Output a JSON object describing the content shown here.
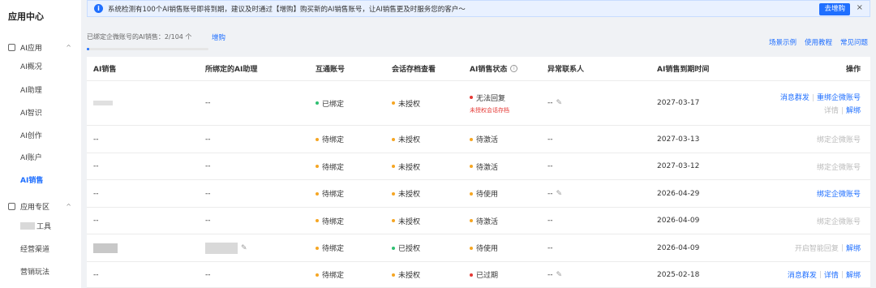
{
  "sidebar": {
    "title": "应用中心",
    "groups": [
      {
        "label": "AI应用",
        "chevron": "^",
        "icon": "grid-icon"
      },
      {
        "label": "应用专区",
        "chevron": "^",
        "icon": "box-icon"
      }
    ],
    "ai_items": [
      "AI概况",
      "AI助理",
      "AI智识",
      "AI创作",
      "AI账户",
      "AI销售"
    ],
    "zone_items": [
      "工具",
      "经营渠道",
      "营销玩法"
    ]
  },
  "notice": {
    "icon": "info-icon",
    "text": "系统检测有100个AI销售账号即将到期，建议及时通过【增购】购买新的AI销售账号，让AI销售更及时服务您的客户～",
    "button": "去增购",
    "close": "×"
  },
  "stats": {
    "text": "已绑定企微账号的AI销售：2/104 个",
    "buy_link": "增购",
    "progress_fraction": 0.019
  },
  "top_links": [
    "场景示例",
    "使用教程",
    "常见问题"
  ],
  "table": {
    "headers": [
      "AI销售",
      "所绑定的AI助理",
      "互通账号",
      "会话存档查看",
      "AI销售状态",
      "异常联系人",
      "AI销售到期时间",
      "操作"
    ],
    "rows": [
      {
        "sales": "",
        "assistant": "--",
        "account": "已绑定",
        "archive": "未授权",
        "status": "无法回复",
        "status_sub": "未授权会话存档",
        "abnormal": "--",
        "expire": "2027-03-17",
        "ops": [
          "消息群发",
          "重绑企微账号",
          "详情",
          "解绑"
        ]
      },
      {
        "sales": "--",
        "assistant": "--",
        "account": "待绑定",
        "archive": "未授权",
        "status": "待激活",
        "status_sub": "",
        "abnormal": "--",
        "expire": "2027-03-13",
        "ops": [
          "绑定企微账号"
        ]
      },
      {
        "sales": "--",
        "assistant": "--",
        "account": "待绑定",
        "archive": "未授权",
        "status": "待激活",
        "status_sub": "",
        "abnormal": "--",
        "expire": "2027-03-12",
        "ops": [
          "绑定企微账号"
        ]
      },
      {
        "sales": "--",
        "assistant": "--",
        "account": "待绑定",
        "archive": "未授权",
        "status": "待使用",
        "status_sub": "",
        "abnormal": "--",
        "expire": "2026-04-29",
        "ops": [
          "绑定企微账号"
        ]
      },
      {
        "sales": "--",
        "assistant": "--",
        "account": "待绑定",
        "archive": "未授权",
        "status": "待激活",
        "status_sub": "",
        "abnormal": "--",
        "expire": "2026-04-09",
        "ops": [
          "绑定企微账号"
        ]
      },
      {
        "sales": "",
        "assistant": "",
        "account": "待绑定",
        "archive": "已授权",
        "status": "待使用",
        "status_sub": "",
        "abnormal": "--",
        "expire": "2026-04-09",
        "ops": [
          "开启智能回复",
          "解绑"
        ]
      },
      {
        "sales": "--",
        "assistant": "--",
        "account": "待绑定",
        "archive": "未授权",
        "status": "已过期",
        "status_sub": "",
        "abnormal": "--",
        "expire": "2025-02-18",
        "ops": [
          "消息群发",
          "详情",
          "解绑"
        ]
      }
    ]
  },
  "colors": {
    "accent": "#1f6fff",
    "green": "#2fbf71",
    "orange": "#f5a623",
    "red": "#e53935"
  }
}
